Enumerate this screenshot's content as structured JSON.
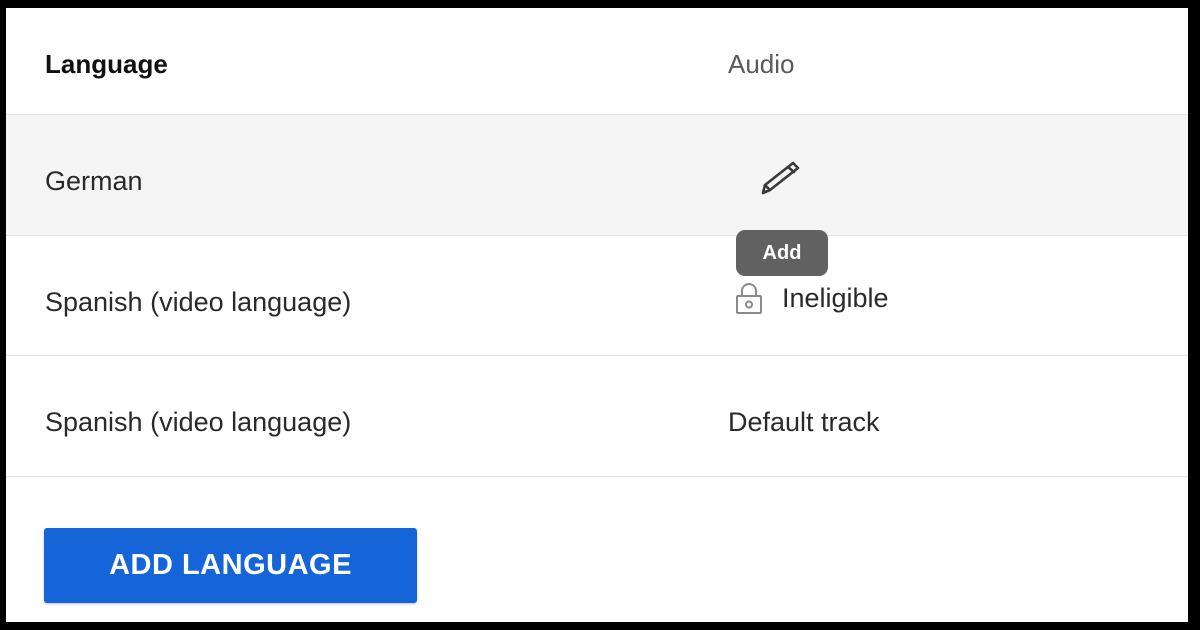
{
  "table": {
    "header": {
      "language_label": "Language",
      "audio_label": "Audio"
    },
    "rows": [
      {
        "language": "German",
        "audio_icon": "pencil-icon",
        "audio_action": "edit"
      },
      {
        "language": "Spanish (video language)",
        "audio_icon": "lock-icon",
        "audio_status": "Ineligible"
      },
      {
        "language": "Spanish (video language)",
        "audio_status": "Default track"
      }
    ]
  },
  "tooltip": {
    "text": "Add"
  },
  "actions": {
    "add_language_label": "ADD LANGUAGE"
  },
  "colors": {
    "primary_button": "#1565d8",
    "hover_row": "#f5f5f5",
    "tooltip_bg": "#616161"
  }
}
